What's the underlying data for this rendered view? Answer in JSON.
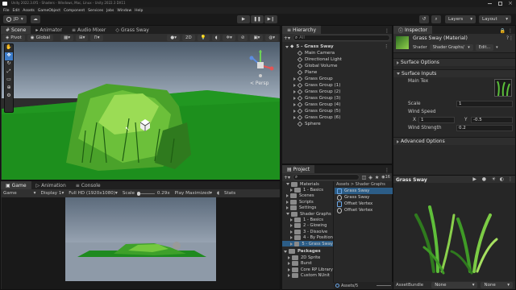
{
  "window": {
    "title": "Unity 2022.3.0f1 - Shaders - Windows, Mac, Linux - Unity 2022.3 DX11"
  },
  "menu": [
    "File",
    "Edit",
    "Assets",
    "GameObject",
    "Component",
    "Services",
    "Jobs",
    "Window",
    "Help"
  ],
  "toolbar": {
    "account": "JD",
    "layers": "Layers",
    "layout": "Layout"
  },
  "scene": {
    "tabs": [
      "Scene",
      "Animator",
      "Audio Mixer",
      "Grass Sway"
    ],
    "pivot": "Pivot",
    "global": "Global",
    "mode_2d": "2D",
    "gizmo_label": "< Persp"
  },
  "game": {
    "tabs": [
      "Game",
      "Animation",
      "Console"
    ],
    "display_mode": "Game",
    "display": "Display 1",
    "resolution": "Full HD (1920x1080)",
    "scale_label": "Scale",
    "scale_value": "0.29x",
    "play_mode": "Play Maximized",
    "stats": "Stats"
  },
  "hierarchy": {
    "title": "Hierarchy",
    "search_placeholder": "All",
    "scene_name": "5 - Grass Sway",
    "items": [
      "Main Camera",
      "Directional Light",
      "Global Volume",
      "Plane",
      "Grass Group",
      "Grass Group (1)",
      "Grass Group (2)",
      "Grass Group (3)",
      "Grass Group (4)",
      "Grass Group (5)",
      "Grass Group (6)",
      "Sphere"
    ],
    "expandable": [
      false,
      false,
      false,
      false,
      true,
      true,
      true,
      true,
      true,
      true,
      true,
      false
    ]
  },
  "project": {
    "title": "Project",
    "badge": "16",
    "tree": [
      "Materials",
      "1 - Basics",
      "Scenes",
      "Scripts",
      "Settings",
      "Shader Graphs",
      "1 - Basics",
      "2 - Glowing",
      "3 - Dissolve",
      "4 - By Position",
      "5 - Grass Sway"
    ],
    "packages_label": "Packages",
    "packages": [
      "2D Sprite",
      "Burst",
      "Core RP Library",
      "Custom NUnit"
    ],
    "breadcrumb": "Assets > Shader Graphs",
    "files": [
      "Grass Sway",
      "Grass Sway",
      "Offset Vertex",
      "Offset Vertex"
    ],
    "footer_path": "Assets/5"
  },
  "inspector": {
    "title": "Inspector",
    "material_name": "Grass Sway (Material)",
    "shader_label": "Shader",
    "shader_value": "Shader Graphs/",
    "edit_label": "Edit...",
    "surface_options": "Surface Options",
    "surface_inputs": "Surface Inputs",
    "main_tex": "Main Tex",
    "scale_label": "Scale",
    "scale_value": "1",
    "wind_speed_label": "Wind Speed",
    "wind_x_label": "X",
    "wind_x": "1",
    "wind_y_label": "Y",
    "wind_y": "-0.5",
    "wind_strength_label": "Wind Strength",
    "wind_strength": "0.2",
    "advanced_options": "Advanced Options",
    "preview_title": "Grass Sway",
    "assetbundle_label": "AssetBundle",
    "assetbundle_value": "None",
    "assetbundle_variant": "None"
  },
  "colors": {
    "accent": "#3d7cc9",
    "ground": "#1f8a1f",
    "sky": "#bcc6d4"
  }
}
